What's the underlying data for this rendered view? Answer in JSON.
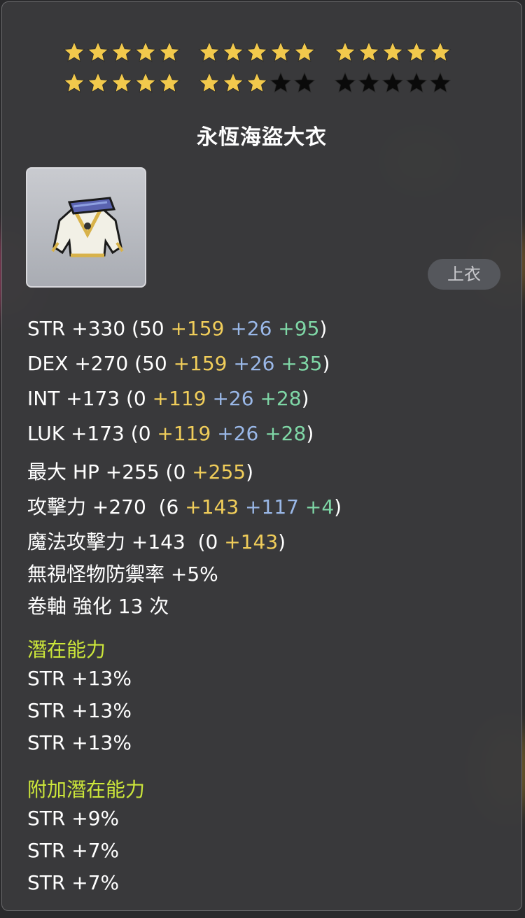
{
  "stars": {
    "row1": [
      "on",
      "on",
      "on",
      "on",
      "on",
      "on",
      "on",
      "on",
      "on",
      "on",
      "on",
      "on",
      "on",
      "on",
      "on"
    ],
    "row2": [
      "on",
      "on",
      "on",
      "on",
      "on",
      "on",
      "on",
      "on",
      "off",
      "off",
      "off",
      "off",
      "off",
      "off",
      "off"
    ],
    "on_color": "#f2c94c",
    "off_color": "#0a0a0a"
  },
  "item": {
    "name": "永恆海盜大衣",
    "icon": "pirate-coat-icon",
    "category": "上衣"
  },
  "stats": [
    {
      "label": "STR +330 (50 ",
      "a": "+159",
      "b": " +26",
      "c": " +95",
      "end": ")"
    },
    {
      "label": "DEX +270 (50 ",
      "a": "+159",
      "b": " +26",
      "c": " +35",
      "end": ")"
    },
    {
      "label": "INT +173 (0 ",
      "a": "+119",
      "b": " +26",
      "c": " +28",
      "end": ")"
    },
    {
      "label": "LUK +173 (0 ",
      "a": "+119",
      "b": " +26",
      "c": " +28",
      "end": ")"
    },
    {
      "label": "最大 HP +255 (0 ",
      "a": "+255",
      "b": "",
      "c": "",
      "end": ")"
    },
    {
      "label": "攻擊力 +270  (6 ",
      "a": "+143",
      "b": " +117",
      "c": " +4",
      "end": ")"
    },
    {
      "label": "魔法攻擊力 +143  (0 ",
      "a": "+143",
      "b": "",
      "c": "",
      "end": ")"
    }
  ],
  "extra": {
    "ignore_def": "無視怪物防禦率 +5%",
    "scroll": "卷軸 強化 13 次"
  },
  "potential": {
    "title": "潛在能力",
    "lines": [
      "STR +13%",
      "STR +13%",
      "STR +13%"
    ]
  },
  "bonus_potential": {
    "title": "附加潛在能力",
    "lines": [
      "STR +9%",
      "STR +7%",
      "STR +7%"
    ]
  }
}
